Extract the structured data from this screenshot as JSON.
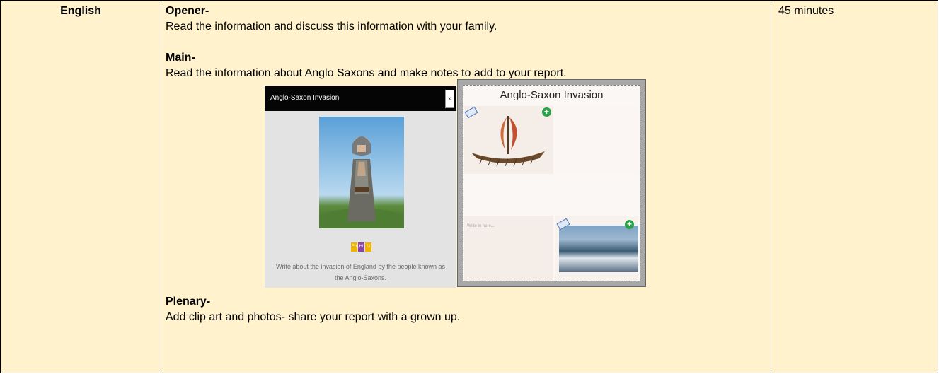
{
  "row": {
    "subject": "English",
    "duration": "45 minutes",
    "opener": {
      "heading": "Opener-",
      "text": "Read the information and discuss this information with your family."
    },
    "main": {
      "heading": "Main-",
      "text": "Read the information about Anglo Saxons and make notes to add to your report."
    },
    "plenary": {
      "heading": "Plenary-",
      "text": "Add clip art and photos- share your report with a grown up."
    }
  },
  "left_panel": {
    "title": "Anglo-Saxon Invasion",
    "close_label": "x",
    "tags": [
      "En",
      "Hi",
      "Li"
    ],
    "caption": "Write about the invasion of England by the people known as the Anglo-Saxons."
  },
  "right_panel": {
    "title": "Anglo-Saxon Invasion",
    "placeholder": "Write in here..."
  },
  "colors": {
    "cell_background": "#fff2cc",
    "tag_en": "#f0b400",
    "tag_hi": "#8e44ad",
    "tag_li": "#f0b400",
    "plus_green": "#2aa147"
  }
}
